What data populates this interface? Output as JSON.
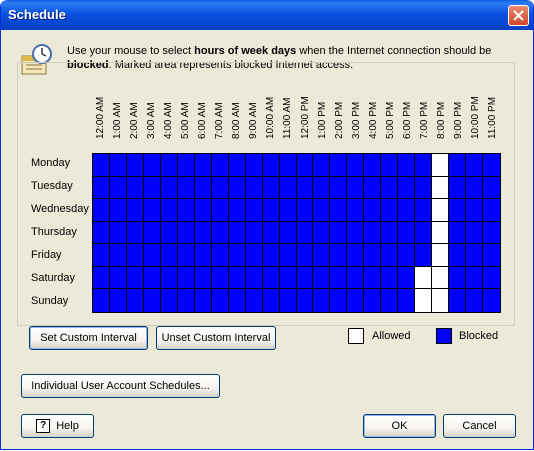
{
  "window": {
    "title": "Schedule"
  },
  "info": {
    "pre": "Use your mouse to select ",
    "bold1": "hours of week days",
    "mid": " when the Internet connection should be ",
    "bold2": "blocked",
    "post": ". Marked area represents blocked Internet access."
  },
  "schedule": {
    "hours": [
      "12:00 AM",
      "1:00 AM",
      "2:00 AM",
      "3:00 AM",
      "4:00 AM",
      "5:00 AM",
      "6:00 AM",
      "7:00 AM",
      "8:00 AM",
      "9:00 AM",
      "10:00 AM",
      "11:00 AM",
      "12:00 PM",
      "1:00 PM",
      "2:00 PM",
      "3:00 PM",
      "4:00 PM",
      "5:00 PM",
      "6:00 PM",
      "7:00 PM",
      "8:00 PM",
      "9:00 PM",
      "10:00 PM",
      "11:00 PM"
    ],
    "days": [
      "Monday",
      "Tuesday",
      "Wednesday",
      "Thursday",
      "Friday",
      "Saturday",
      "Sunday"
    ],
    "allowed_hours_by_day": [
      [
        20
      ],
      [
        20
      ],
      [
        20
      ],
      [
        20
      ],
      [
        20
      ],
      [
        19,
        20
      ],
      [
        19,
        20
      ]
    ],
    "colors": {
      "blocked": "#0000ff",
      "allowed": "#ffffff"
    }
  },
  "buttons": {
    "set_custom": "Set Custom Interval",
    "unset_custom": "Unset Custom Interval",
    "user_schedules": "Individual User Account Schedules...",
    "help": "Help",
    "ok": "OK",
    "cancel": "Cancel"
  },
  "legend": {
    "allowed": "Allowed",
    "blocked": "Blocked"
  },
  "icons": {
    "dialog": "clock-calendar-icon",
    "close": "close-icon",
    "help": "help-icon"
  }
}
